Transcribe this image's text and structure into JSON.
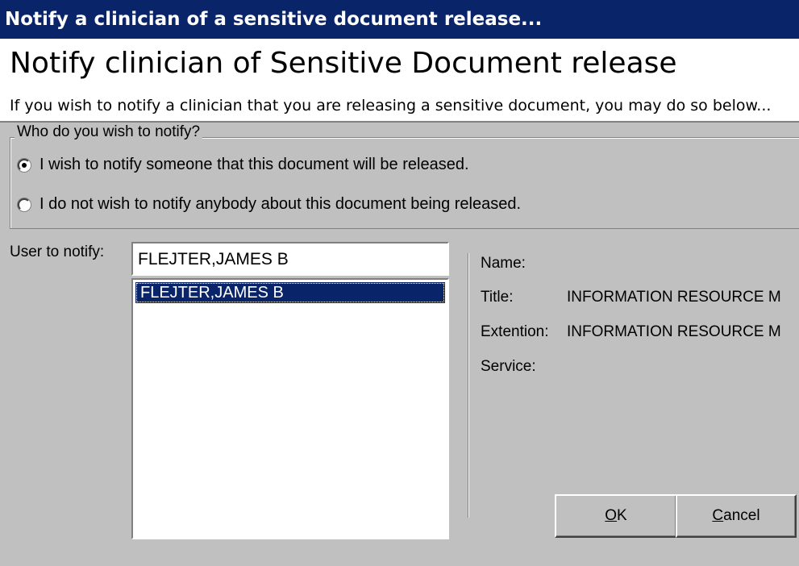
{
  "window": {
    "title": "Notify a clinician of a sensitive document release..."
  },
  "header": {
    "title": "Notify clinician of Sensitive Document release",
    "description": "If you wish to notify a clinician that you are releasing a sensitive document, you may do so below..."
  },
  "notify_group": {
    "legend": "Who do you wish to notify?",
    "options": [
      {
        "label": "I wish to notify someone that this document will be released.",
        "checked": true
      },
      {
        "label": "I do not wish to notify anybody about this document being released.",
        "checked": false
      }
    ]
  },
  "user": {
    "label": "User to notify:",
    "input_value": "FLEJTER,JAMES B",
    "list_items": [
      {
        "label": "FLEJTER,JAMES B",
        "selected": true
      }
    ]
  },
  "details": {
    "name_label": "Name:",
    "name_value": "",
    "title_label": "Title:",
    "title_value": "INFORMATION RESOURCE M",
    "extension_label": "Extention:",
    "extension_value": "INFORMATION RESOURCE M",
    "service_label": "Service:",
    "service_value": ""
  },
  "buttons": {
    "ok_accel": "O",
    "ok_rest": "K",
    "cancel_accel": "C",
    "cancel_rest": "ancel"
  },
  "colors": {
    "title_bar": "#0a246a",
    "face": "#c0c0c0",
    "selection": "#0a246a"
  }
}
